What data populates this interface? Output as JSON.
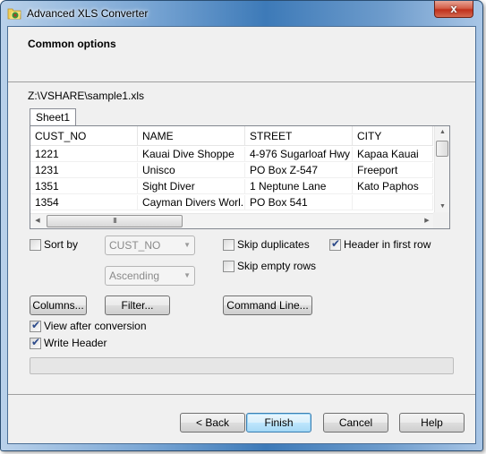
{
  "window": {
    "title": "Advanced XLS Converter",
    "app_icon": "folder-xls-icon",
    "close_label": "x"
  },
  "header": {
    "title": "Common options"
  },
  "file_path": "Z:\\VSHARE\\sample1.xls",
  "sheet_tabs": [
    {
      "label": "Sheet1",
      "active": true
    }
  ],
  "grid": {
    "columns": [
      "CUST_NO",
      "NAME",
      "STREET",
      "CITY"
    ],
    "rows": [
      [
        "1221",
        "Kauai Dive Shoppe",
        "4-976 Sugarloaf Hwy",
        "Kapaa Kauai"
      ],
      [
        "1231",
        "Unisco",
        "PO Box Z-547",
        "Freeport"
      ],
      [
        "1351",
        "Sight Diver",
        "1 Neptune Lane",
        "Kato Paphos"
      ],
      [
        "1354",
        "Cayman Divers Worl...",
        "PO Box 541",
        ""
      ]
    ],
    "hscroll_grip": "III"
  },
  "options": {
    "sort_by": {
      "label": "Sort by",
      "checked": false
    },
    "sort_field": {
      "value": "CUST_NO",
      "enabled": false
    },
    "sort_order": {
      "value": "Ascending",
      "enabled": false
    },
    "skip_duplicates": {
      "label": "Skip duplicates",
      "checked": false
    },
    "skip_empty_rows": {
      "label": "Skip empty rows",
      "checked": false
    },
    "header_in_first_row": {
      "label": "Header in first row",
      "checked": true
    },
    "view_after_conversion": {
      "label": "View after conversion",
      "checked": true
    },
    "write_header": {
      "label": "Write Header",
      "checked": true
    }
  },
  "buttons": {
    "columns": "Columns...",
    "filter": "Filter...",
    "command_line": "Command Line...",
    "back": "< Back",
    "finish": "Finish",
    "cancel": "Cancel",
    "help": "Help"
  },
  "progress": {
    "value": 0
  }
}
